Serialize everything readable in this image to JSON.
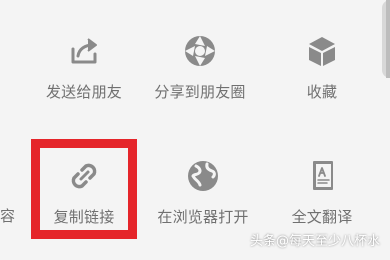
{
  "share_menu": {
    "row1": [
      {
        "label": "发送给朋友",
        "icon": "send-to-friend-icon"
      },
      {
        "label": "分享到朋友圈",
        "icon": "moments-icon"
      },
      {
        "label": "收藏",
        "icon": "favorite-cube-icon"
      }
    ],
    "row2": {
      "cut_label": "容",
      "items": [
        {
          "label": "复制链接",
          "icon": "link-icon"
        },
        {
          "label": "在浏览器打开",
          "icon": "globe-icon"
        },
        {
          "label": "全文翻译",
          "icon": "translate-document-icon"
        }
      ]
    }
  },
  "highlight_color": "#e5252a",
  "watermark": "头条@每天至少八杯水"
}
